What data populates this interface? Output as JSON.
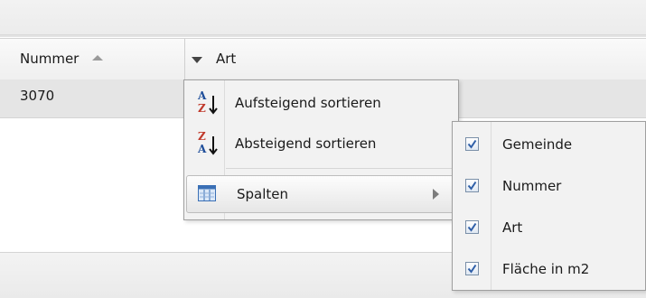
{
  "grid": {
    "columns": [
      {
        "label": "Nummer",
        "sort": "ascending"
      },
      {
        "label": "Art"
      }
    ],
    "rows": [
      {
        "nummer": "3070",
        "art": ""
      }
    ]
  },
  "column_menu": {
    "items": [
      {
        "label": "Aufsteigend sortieren",
        "icon": "sort-ascending-icon"
      },
      {
        "label": "Absteigend sortieren",
        "icon": "sort-descending-icon"
      },
      {
        "label": "Spalten",
        "icon": "columns-icon",
        "has_submenu": true
      }
    ]
  },
  "columns_submenu": {
    "items": [
      {
        "label": "Gemeinde",
        "checked": true
      },
      {
        "label": "Nummer",
        "checked": true
      },
      {
        "label": "Art",
        "checked": true
      },
      {
        "label": "Fläche in m2",
        "checked": true
      }
    ]
  },
  "colors": {
    "checkmark": "#2f5fa8",
    "sort_icon_letters": "#1f4e9a"
  },
  "icon_letters": {
    "first": "A",
    "last": "Z"
  }
}
